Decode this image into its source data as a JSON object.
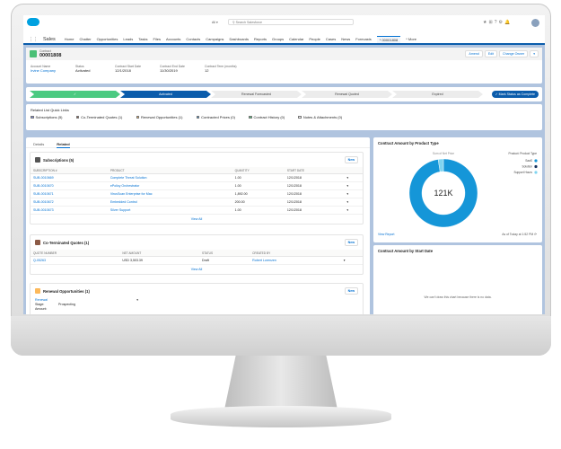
{
  "header": {
    "search_scope": "All",
    "search_placeholder": "Search Salesforce",
    "app_name": "Sales"
  },
  "nav": [
    "Home",
    "Chatter",
    "Opportunities",
    "Leads",
    "Tasks",
    "Files",
    "Accounts",
    "Contacts",
    "Campaigns",
    "Dashboards",
    "Reports",
    "Groups",
    "Calendar",
    "People",
    "Cases",
    "News",
    "Forecasts"
  ],
  "nav_active_tab": "* 00001808",
  "nav_more": "* More",
  "record": {
    "type": "Contract",
    "number": "00001808",
    "actions": [
      "Amend",
      "Edit",
      "Change Owner"
    ],
    "fields": [
      {
        "label": "Account Name",
        "value": "Irvine Company",
        "link": true
      },
      {
        "label": "Status",
        "value": "Activated"
      },
      {
        "label": "Contract Start Date",
        "value": "12/1/2018"
      },
      {
        "label": "Contract End Date",
        "value": "11/30/2019"
      },
      {
        "label": "Contract Term (months)",
        "value": "12"
      }
    ]
  },
  "path": {
    "steps": [
      "✓",
      "Activated",
      "Renewal Forecasted",
      "Renewal Quoted",
      "Expired"
    ],
    "mark_button": "✓ Mark Status as Complete"
  },
  "quick_links": {
    "title": "Related List Quick Links",
    "items": [
      "Subscriptions (5)",
      "Co-Terminated Quotes (1)",
      "Renewal Opportunities (1)",
      "Contracted Prices (0)",
      "Contract History (0)",
      "Notes & Attachments (0)"
    ]
  },
  "tabs": [
    "Details",
    "Related"
  ],
  "subscriptions": {
    "title": "Subscriptions (5)",
    "new": "New",
    "columns": [
      "SUBSCRIPTION #",
      "PRODUCT",
      "QUANTITY",
      "START DATE"
    ],
    "rows": [
      [
        "SUB-0010669",
        "Complete Threat Solution",
        "1.00",
        "12/1/2018"
      ],
      [
        "SUB-0010670",
        "ePolicy Orchestrator",
        "1.00",
        "12/1/2018"
      ],
      [
        "SUB-0010671",
        "VirusScan Enterprise for Mac",
        "1,892.00",
        "12/1/2018"
      ],
      [
        "SUB-0010672",
        "Embedded Control",
        "200.00",
        "12/1/2018"
      ],
      [
        "SUB-0010673",
        "Silver Support",
        "1.00",
        "12/1/2018"
      ]
    ],
    "view_all": "View All"
  },
  "quotes": {
    "title": "Co-Terminated Quotes (1)",
    "new": "New",
    "columns": [
      "QUOTE NUMBER",
      "NET AMOUNT",
      "STATUS",
      "CREATED BY"
    ],
    "rows": [
      [
        "Q-05263",
        "USD 3,503.39",
        "Draft",
        "Robert Lorenzen"
      ]
    ],
    "view_all": "View All"
  },
  "renewals": {
    "title": "Renewal Opportunities (1)",
    "new": "New",
    "name": "Renewal",
    "stage_label": "Stage:",
    "stage": "Prospecting",
    "amount_label": "Amount:"
  },
  "chart_data": {
    "type": "pie",
    "title": "Contract Amount by Product Type",
    "subtitle": "Sum of Net Price",
    "center_label": "121K",
    "legend_title": "Product: Product Type",
    "legend_position": "top-right",
    "categories": [
      "SaaS",
      "Solution",
      "Support Hours"
    ],
    "values": [
      118,
      0,
      3
    ],
    "colors": [
      "#1596d8",
      "#16325c",
      "#7fd4f0"
    ],
    "view_report": "View Report",
    "timestamp": "As of Today at 1:52 PM"
  },
  "chart2": {
    "title": "Contract Amount by Start Date",
    "empty": "We can't draw this chart because there is no data."
  }
}
